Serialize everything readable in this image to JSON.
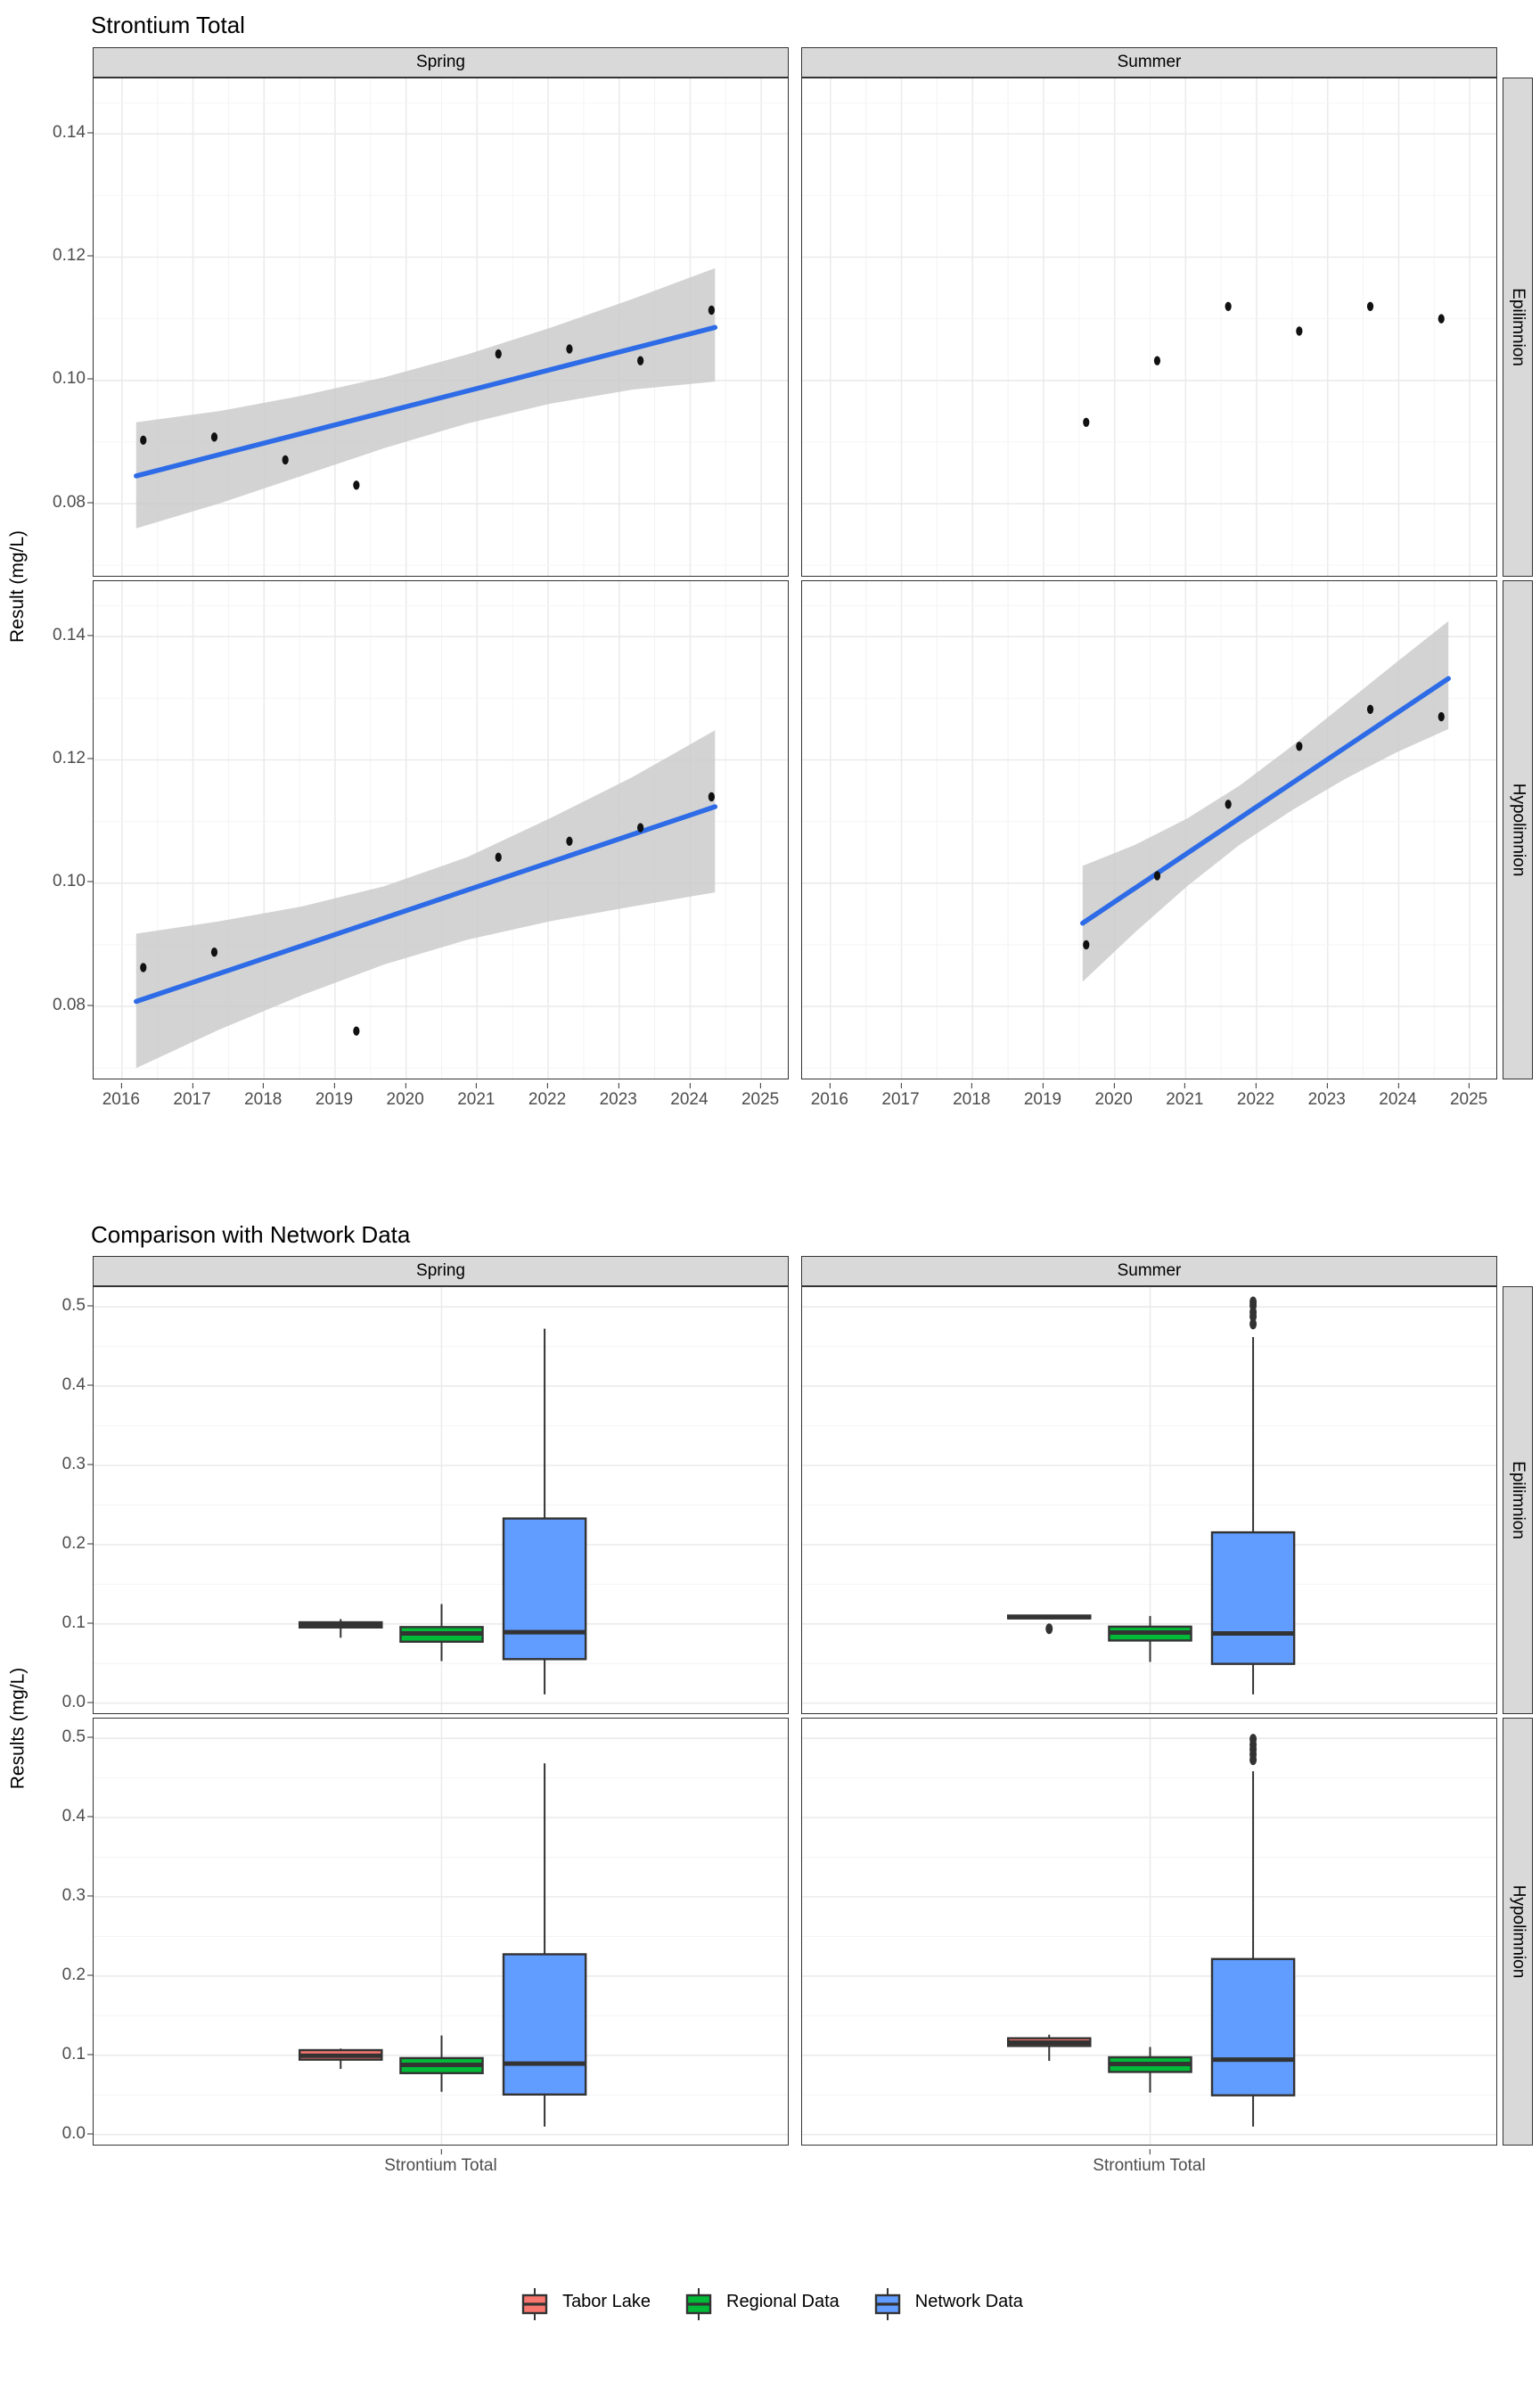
{
  "figure1": {
    "title": "Strontium Total",
    "ylabel": "Result (mg/L)",
    "col_strips": [
      "Spring",
      "Summer"
    ],
    "row_strips": [
      "Epilimnion",
      "Hypolimnion"
    ],
    "xticks": [
      "2016",
      "2017",
      "2018",
      "2019",
      "2020",
      "2021",
      "2022",
      "2023",
      "2024",
      "2025"
    ],
    "yticks_epi": [
      "0.14",
      "0.12",
      "0.10",
      "0.08"
    ],
    "yticks_hypo": [
      "0.14",
      "0.12",
      "0.10",
      "0.08"
    ]
  },
  "figure2": {
    "title": "Comparison with Network Data",
    "ylabel": "Results (mg/L)",
    "col_strips": [
      "Spring",
      "Summer"
    ],
    "row_strips": [
      "Epilimnion",
      "Hypolimnion"
    ],
    "yticks": [
      "0.5",
      "0.4",
      "0.3",
      "0.2",
      "0.1",
      "0.0"
    ],
    "xtick": "Strontium Total"
  },
  "legend": {
    "items": [
      {
        "label": "Tabor Lake",
        "color": "#F8766D"
      },
      {
        "label": "Regional Data",
        "color": "#00BA38"
      },
      {
        "label": "Network Data",
        "color": "#619CFF"
      }
    ]
  },
  "colors": {
    "trend_line": "#2E6BE6",
    "ribbon": "#c9c9c9",
    "point": "#111111",
    "strip_bg": "#d9d9d9",
    "panel_border": "#333333",
    "grid_major": "#ebebeb",
    "grid_minor": "#f4f4f4"
  },
  "chart_data": [
    {
      "type": "scatter",
      "title": "Strontium Total",
      "xlabel": "",
      "ylabel": "Result (mg/L)",
      "grid": true,
      "legend_position": "none",
      "xlim": [
        2015.6,
        2025.4
      ],
      "ylim": [
        0.068,
        0.149
      ],
      "facets": [
        {
          "col": "Spring",
          "row": "Epilimnion",
          "points": [
            {
              "x": 2016.3,
              "y": 0.0903
            },
            {
              "x": 2017.3,
              "y": 0.0908
            },
            {
              "x": 2018.3,
              "y": 0.0871
            },
            {
              "x": 2019.3,
              "y": 0.083
            },
            {
              "x": 2021.3,
              "y": 0.1043
            },
            {
              "x": 2022.3,
              "y": 0.1051
            },
            {
              "x": 2023.3,
              "y": 0.1032
            },
            {
              "x": 2024.3,
              "y": 0.1114
            }
          ],
          "trend": {
            "x0": 2016.2,
            "y0": 0.0845,
            "x1": 2024.35,
            "y1": 0.1086
          },
          "ribbon": {
            "x0": 2016.2,
            "x1": 2024.35,
            "lower": [
              0.076,
              0.08,
              0.0845,
              0.089,
              0.093,
              0.0962,
              0.0985,
              0.0998
            ],
            "upper": [
              0.0932,
              0.095,
              0.0975,
              0.1005,
              0.1042,
              0.1085,
              0.1132,
              0.1182
            ]
          }
        },
        {
          "col": "Summer",
          "row": "Epilimnion",
          "points": [
            {
              "x": 2019.6,
              "y": 0.0932
            },
            {
              "x": 2020.6,
              "y": 0.1032
            },
            {
              "x": 2021.6,
              "y": 0.112
            },
            {
              "x": 2022.6,
              "y": 0.108
            },
            {
              "x": 2023.6,
              "y": 0.112
            },
            {
              "x": 2024.6,
              "y": 0.11
            }
          ],
          "trend": null,
          "ribbon": null
        },
        {
          "col": "Spring",
          "row": "Hypolimnion",
          "points": [
            {
              "x": 2016.3,
              "y": 0.0863
            },
            {
              "x": 2017.3,
              "y": 0.0888
            },
            {
              "x": 2019.3,
              "y": 0.076
            },
            {
              "x": 2021.3,
              "y": 0.1042
            },
            {
              "x": 2022.3,
              "y": 0.1068
            },
            {
              "x": 2023.3,
              "y": 0.109
            },
            {
              "x": 2024.3,
              "y": 0.114
            }
          ],
          "trend": {
            "x0": 2016.2,
            "y0": 0.0808,
            "x1": 2024.35,
            "y1": 0.1124
          },
          "ribbon": {
            "x0": 2016.2,
            "x1": 2024.35,
            "lower": [
              0.07,
              0.0762,
              0.0818,
              0.0868,
              0.0908,
              0.0938,
              0.0962,
              0.0985
            ],
            "upper": [
              0.0918,
              0.0938,
              0.0962,
              0.0995,
              0.1042,
              0.1105,
              0.1172,
              0.1248
            ]
          }
        },
        {
          "col": "Summer",
          "row": "Hypolimnion",
          "points": [
            {
              "x": 2019.6,
              "y": 0.09
            },
            {
              "x": 2020.6,
              "y": 0.1012
            },
            {
              "x": 2021.6,
              "y": 0.1128
            },
            {
              "x": 2022.6,
              "y": 0.1222
            },
            {
              "x": 2023.6,
              "y": 0.1282
            },
            {
              "x": 2024.6,
              "y": 0.127
            }
          ],
          "trend": {
            "x0": 2019.55,
            "y0": 0.0935,
            "x1": 2024.7,
            "y1": 0.1332
          },
          "ribbon": {
            "x0": 2019.55,
            "x1": 2024.7,
            "lower": [
              0.084,
              0.092,
              0.0995,
              0.1062,
              0.1118,
              0.1168,
              0.1212,
              0.125
            ],
            "upper": [
              0.1028,
              0.1062,
              0.1105,
              0.1158,
              0.1222,
              0.129,
              0.1358,
              0.1425
            ]
          }
        }
      ]
    },
    {
      "type": "boxplot",
      "title": "Comparison with Network Data",
      "xlabel": "Strontium Total",
      "ylabel": "Results (mg/L)",
      "grid": true,
      "legend_position": "bottom",
      "ylim": [
        -0.015,
        0.525
      ],
      "yticks": [
        0.0,
        0.1,
        0.2,
        0.3,
        0.4,
        0.5
      ],
      "groups": [
        "Tabor Lake",
        "Regional Data",
        "Network Data"
      ],
      "facets": [
        {
          "col": "Spring",
          "row": "Epilimnion",
          "boxes": [
            {
              "group": "Tabor Lake",
              "min": 0.0825,
              "q1": 0.0955,
              "median": 0.0985,
              "q3": 0.102,
              "max": 0.106,
              "outliers": []
            },
            {
              "group": "Regional Data",
              "min": 0.053,
              "q1": 0.0775,
              "median": 0.088,
              "q3": 0.096,
              "max": 0.125,
              "outliers": []
            },
            {
              "group": "Network Data",
              "min": 0.011,
              "q1": 0.0555,
              "median": 0.0895,
              "q3": 0.233,
              "max": 0.4725,
              "outliers": []
            }
          ]
        },
        {
          "col": "Summer",
          "row": "Epilimnion",
          "boxes": [
            {
              "group": "Tabor Lake",
              "min": 0.106,
              "q1": 0.107,
              "median": 0.1085,
              "q3": 0.1105,
              "max": 0.111,
              "outliers": [
                0.0938
              ]
            },
            {
              "group": "Regional Data",
              "min": 0.052,
              "q1": 0.079,
              "median": 0.089,
              "q3": 0.0965,
              "max": 0.11,
              "outliers": []
            },
            {
              "group": "Network Data",
              "min": 0.011,
              "q1": 0.0495,
              "median": 0.088,
              "q3": 0.2155,
              "max": 0.462,
              "outliers": [
                0.4785,
                0.488,
                0.4935,
                0.502,
                0.5065
              ]
            }
          ]
        },
        {
          "col": "Spring",
          "row": "Hypolimnion",
          "boxes": [
            {
              "group": "Tabor Lake",
              "min": 0.0828,
              "q1": 0.0945,
              "median": 0.0995,
              "q3": 0.1065,
              "max": 0.1085,
              "outliers": []
            },
            {
              "group": "Regional Data",
              "min": 0.054,
              "q1": 0.0775,
              "median": 0.088,
              "q3": 0.0965,
              "max": 0.125,
              "outliers": []
            },
            {
              "group": "Network Data",
              "min": 0.01,
              "q1": 0.0505,
              "median": 0.0895,
              "q3": 0.2275,
              "max": 0.4685,
              "outliers": []
            }
          ]
        },
        {
          "col": "Summer",
          "row": "Hypolimnion",
          "boxes": [
            {
              "group": "Tabor Lake",
              "min": 0.093,
              "q1": 0.1118,
              "median": 0.116,
              "q3": 0.1215,
              "max": 0.126,
              "outliers": []
            },
            {
              "group": "Regional Data",
              "min": 0.053,
              "q1": 0.079,
              "median": 0.089,
              "q3": 0.0975,
              "max": 0.1105,
              "outliers": []
            },
            {
              "group": "Network Data",
              "min": 0.01,
              "q1": 0.0495,
              "median": 0.0945,
              "q3": 0.2215,
              "max": 0.4585,
              "outliers": [
                0.473,
                0.48,
                0.486,
                0.492,
                0.499
              ]
            }
          ]
        }
      ]
    }
  ]
}
